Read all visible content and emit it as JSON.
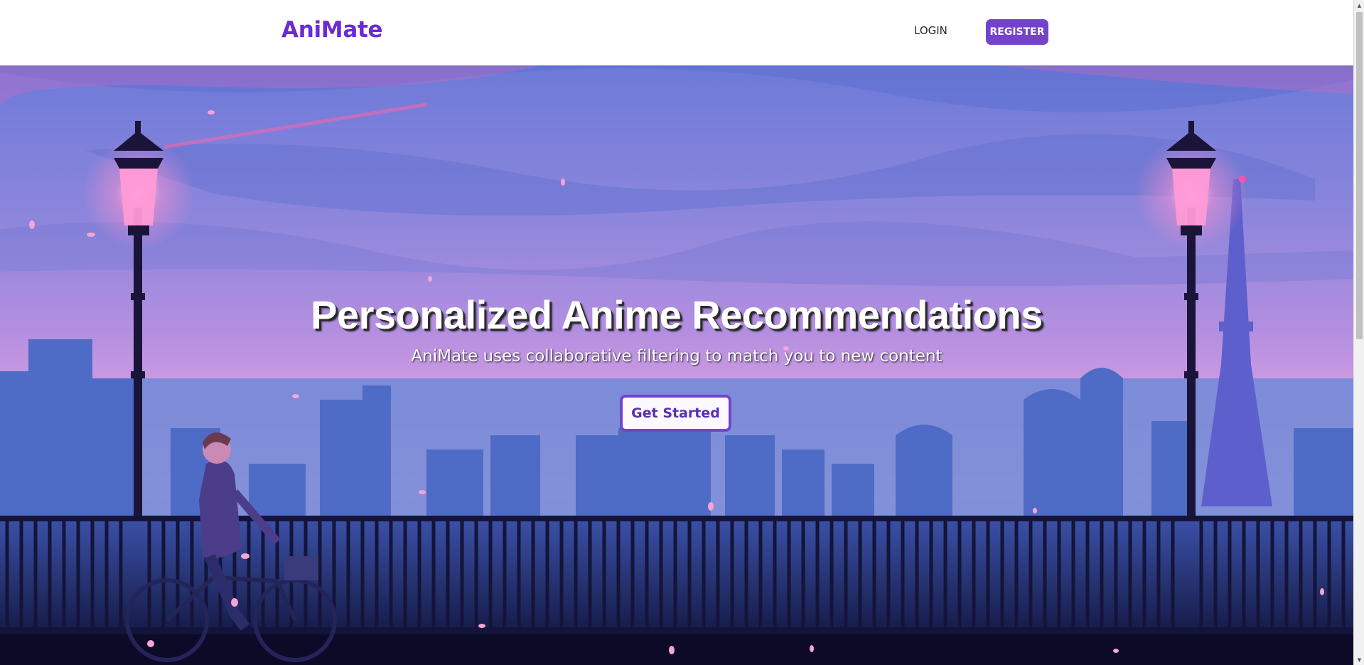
{
  "nav": {
    "brand": "AniMate",
    "login_label": "LOGIN",
    "register_label": "REGISTER"
  },
  "hero": {
    "title": "Personalized Anime Recommendations",
    "subtitle": "AniMate uses collaborative filtering to match you to new content",
    "cta_label": "Get Started",
    "background_icon": "anime-city-skyline-illustration"
  },
  "colors": {
    "brand": "#6a2bd0",
    "accent": "#7443cc",
    "sky_top": "#6f78d6",
    "sky_pink": "#e0a8e8",
    "city_blue": "#4f6fc4",
    "railing": "#14143a"
  },
  "scrollbar": {
    "up_icon": "▲",
    "down_icon": "▼"
  }
}
